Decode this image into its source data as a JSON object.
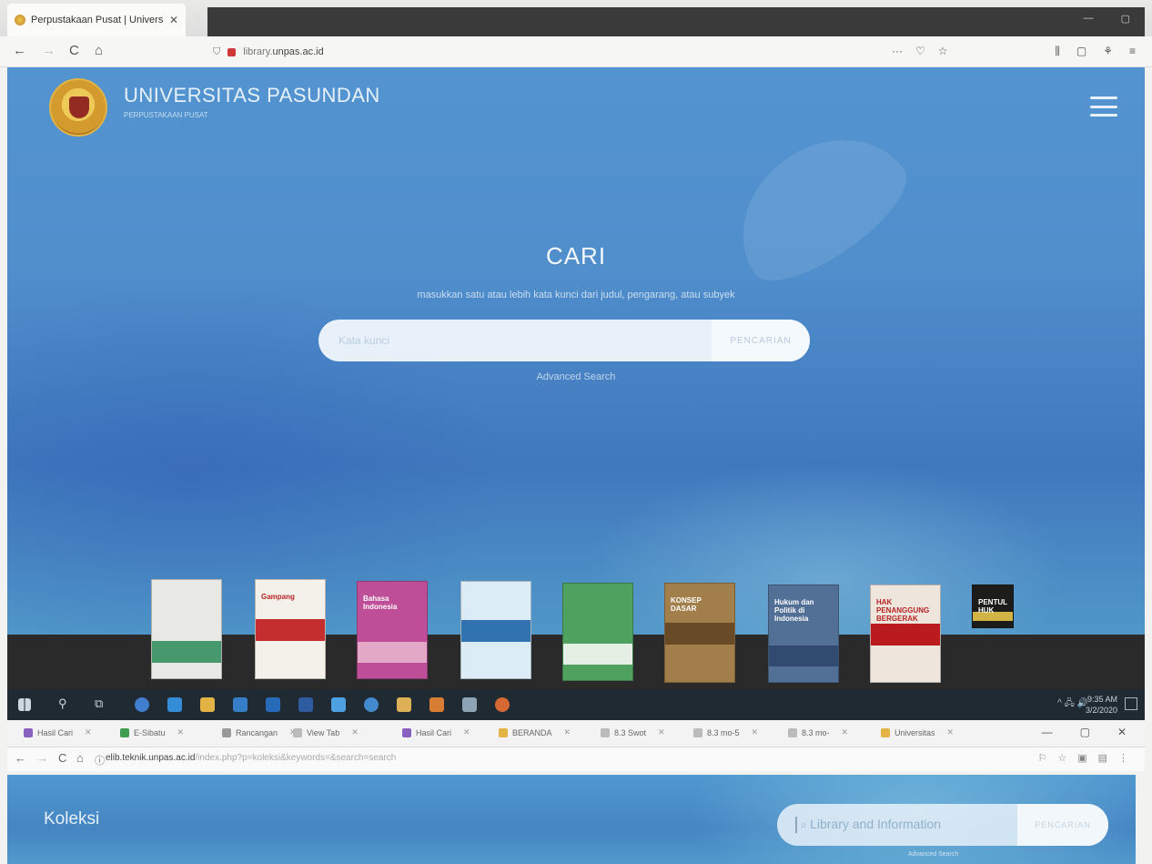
{
  "firefox": {
    "tab_title": "Perpustakaan Pusat | Universi...",
    "close_glyph": "✕",
    "new_tab_glyph": "+",
    "url_prefix": "library.",
    "url_domain": "unpas.ac.id",
    "nav": {
      "back": "←",
      "forward": "→",
      "reload": "C",
      "home": "⌂"
    },
    "right_icons": {
      "more": "···",
      "pocket": "♡",
      "star": "☆"
    },
    "far_icons": {
      "library": "⫼",
      "sidebar": "▢",
      "ext": "⚘",
      "menu": "≡"
    },
    "win": {
      "min": "—",
      "max": "▢"
    }
  },
  "hero": {
    "site_title": "UNIVERSITAS PASUNDAN",
    "site_subtitle": "PERPUSTAKAAN PUSAT",
    "search_title": "CARI",
    "search_hint": "masukkan satu atau lebih kata kunci dari judul, pengarang, atau subyek",
    "search_placeholder": "Kata kunci",
    "search_button": "PENCARIAN",
    "advanced_link": "Advanced Search"
  },
  "books": [
    {
      "title": "",
      "bg": "#e8e8e4",
      "band": "#3f9a6a"
    },
    {
      "title": "Gampang",
      "bg": "#f4f1ea",
      "band": "#d12a2a"
    },
    {
      "title": "Bahasa Indonesia",
      "bg": "#c84b9d",
      "band": "#e7a6c8"
    },
    {
      "title": "",
      "bg": "#d9ecf7",
      "band": "#2b73b8"
    },
    {
      "title": "",
      "bg": "#48a35a",
      "band": "#e5efe3"
    },
    {
      "title": "KONSEP DASAR",
      "bg": "#a67e44",
      "band": "#6b4a22"
    },
    {
      "title": "Hukum dan Politik di Indonesia",
      "bg": "#4f6f9b",
      "band": "#2e4b74"
    },
    {
      "title": "HAK PENANGGUNG BERGERAK",
      "bg": "#efe6dc",
      "band": "#c8171c"
    },
    {
      "title": "PENTUL HUK",
      "bg": "#1c1c1a",
      "band": "#d5b43a"
    }
  ],
  "taskbar": {
    "search_glyph": "⚲",
    "view_glyph": "⧉",
    "tray": "^ 🖧 🔊",
    "time": "9:35 AM",
    "date": "3/2/2020",
    "apps": [
      {
        "name": "edge-old",
        "color": "#3b7fd8"
      },
      {
        "name": "ie",
        "color": "#2c8fe0"
      },
      {
        "name": "explorer",
        "color": "#e8b33a"
      },
      {
        "name": "store",
        "color": "#2f7fd1"
      },
      {
        "name": "mail",
        "color": "#1f6cc4"
      },
      {
        "name": "word",
        "color": "#2b5ca8"
      },
      {
        "name": "phone",
        "color": "#46a2e8"
      },
      {
        "name": "chrome",
        "color": "#3d8bd8"
      },
      {
        "name": "cleaner",
        "color": "#e3b04b"
      },
      {
        "name": "office",
        "color": "#e07b2a"
      },
      {
        "name": "photos",
        "color": "#8da3b8"
      },
      {
        "name": "firefox",
        "color": "#e0662b"
      }
    ]
  },
  "chrome": {
    "tabs": [
      {
        "label": "Hasil Cari",
        "color": "#8b5fc7"
      },
      {
        "label": "E-Sibatu",
        "color": "#3aa14a"
      },
      {
        "label": "Rancangan",
        "color": "#999999"
      },
      {
        "label": "View Tab",
        "color": "#bbbbbb"
      },
      {
        "label": "Hasil Cari",
        "color": "#8b5fc7"
      },
      {
        "label": "BERANDA",
        "color": "#e8b33a"
      },
      {
        "label": "8.3 Swot",
        "color": "#bbbbbb"
      },
      {
        "label": "8.3 mo-5",
        "color": "#bbbbbb"
      },
      {
        "label": "8.3 mo-",
        "color": "#bbbbbb"
      },
      {
        "label": "Universitas",
        "color": "#e8b33a"
      }
    ],
    "tab_close": "✕",
    "win": {
      "min": "—",
      "max": "▢",
      "close": "✕"
    },
    "nav": {
      "back": "←",
      "forward": "→",
      "reload": "C",
      "home": "⌂",
      "info": "ⓘ"
    },
    "url_domain": "elib.teknik.unpas.ac.id",
    "url_path": "/index.php?p=koleksi&keywords=&search=search",
    "actions": {
      "translate": "⚐",
      "star": "☆",
      "ext1": "▣",
      "ext2": "▤",
      "menu": "⋮"
    },
    "page": {
      "title": "Koleksi",
      "search_query": "Library and Information",
      "search_button": "PENCARIAN",
      "advanced_link": "Advanced Search"
    }
  }
}
